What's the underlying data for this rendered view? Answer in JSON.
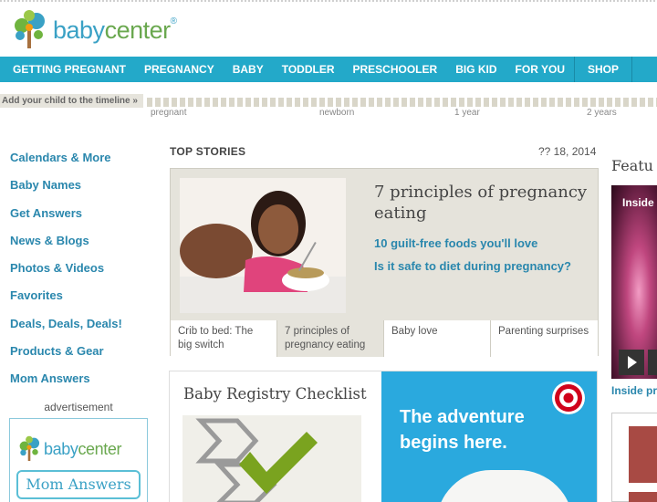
{
  "brand": {
    "name_part1": "baby",
    "name_part2": "center",
    "trademark": "®",
    "colors": {
      "blue": "#3aa1c5",
      "green": "#6aa84f",
      "nav": "#23a9c9"
    }
  },
  "nav": {
    "items": [
      "GETTING PREGNANT",
      "PREGNANCY",
      "BABY",
      "TODDLER",
      "PRESCHOOLER",
      "BIG KID",
      "FOR YOU"
    ],
    "shop": "SHOP"
  },
  "timeline": {
    "add_label": "Add your child to the timeline",
    "arrow": "»",
    "stages": [
      "pregnant",
      "newborn",
      "1 year",
      "2 years"
    ]
  },
  "sidebar": {
    "links": [
      "Calendars & More",
      "Baby Names",
      "Get Answers",
      "News & Blogs",
      "Photos & Videos",
      "Favorites",
      "Deals, Deals, Deals!",
      "Products & Gear",
      "Mom Answers"
    ],
    "advertisement": "advertisement",
    "ad": {
      "brand_part1": "baby",
      "brand_part2": "center",
      "button": "Mom Answers"
    }
  },
  "top_stories": {
    "heading": "TOP STORIES",
    "date": "?? 18, 2014",
    "headline": "7 principles of pregnancy eating",
    "links": [
      "10 guilt-free foods you'll love",
      "Is it safe to diet during pregnancy?"
    ],
    "tabs": [
      {
        "label": "Crib to bed: The big switch",
        "active": false
      },
      {
        "label": "7 principles of pregnancy eating",
        "active": true
      },
      {
        "label": "Baby love",
        "active": false
      },
      {
        "label": "Parenting surprises",
        "active": false
      }
    ]
  },
  "registry": {
    "title": "Baby Registry Checklist",
    "ad_text_line1": "The adventure",
    "ad_text_line2": "begins here."
  },
  "featured": {
    "title": "Featu",
    "overlay": "Inside",
    "caption": "Inside pre"
  }
}
